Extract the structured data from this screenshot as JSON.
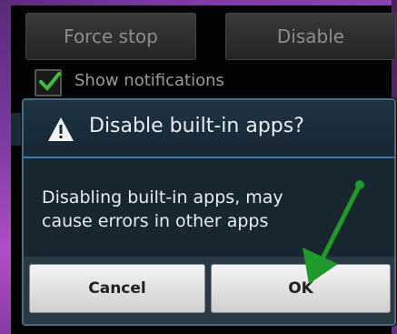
{
  "background": {
    "force_stop_label": "Force stop",
    "disable_label": "Disable",
    "show_notifications_label": "Show notifications"
  },
  "dialog": {
    "title": "Disable built-in apps?",
    "message_line1": "Disabling built-in apps, may",
    "message_line2": "cause errors in other apps",
    "cancel_label": "Cancel",
    "ok_label": "OK"
  },
  "colors": {
    "accent_blue": "#2f7fb0",
    "annotation_arrow": "#1f9a2b",
    "frame_purple": "#7b3aa0"
  },
  "icons": {
    "dialog_icon": "warning-icon",
    "checkbox_icon": "checkmark-icon"
  }
}
